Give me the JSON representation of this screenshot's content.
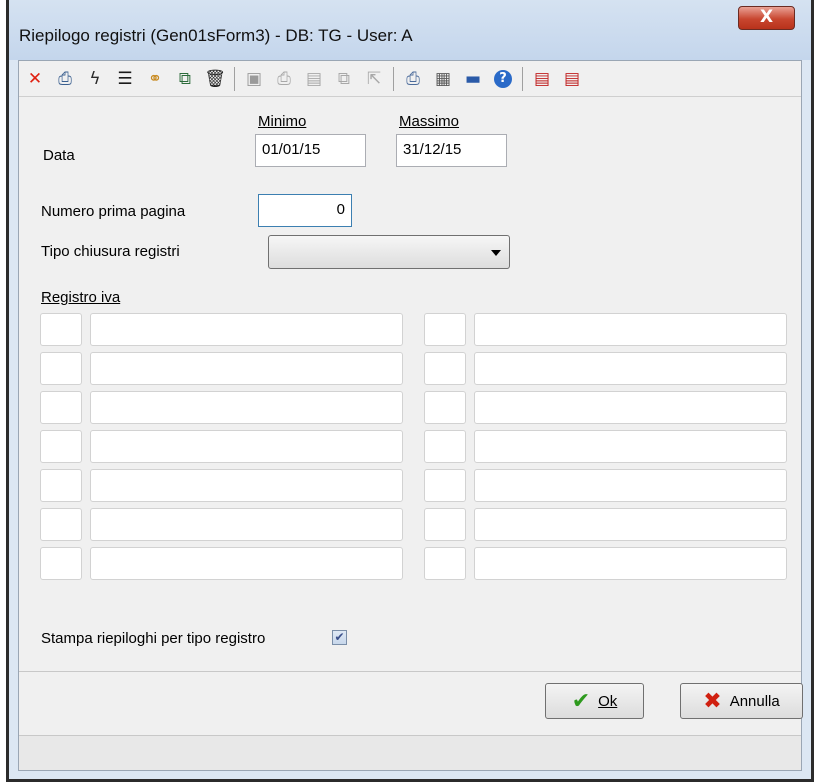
{
  "window": {
    "title": "Riepilogo registri   (Gen01sForm3) - DB: TG - User: A",
    "close_glyph": "X"
  },
  "toolbar": {
    "groups": [
      [
        {
          "name": "delete-icon",
          "glyph": "✕",
          "color": "#e02010"
        },
        {
          "name": "print-icon",
          "glyph": "⎙",
          "color": "#3a5f8f"
        },
        {
          "name": "lightning-icon",
          "glyph": "ϟ",
          "color": "#2a2a2a"
        },
        {
          "name": "list-icon",
          "glyph": "☰",
          "color": "#1a1a1a"
        },
        {
          "name": "handshake-icon",
          "glyph": "⚭",
          "color": "#c88a20"
        },
        {
          "name": "window-icon",
          "glyph": "⧉",
          "color": "#2b6b3a"
        },
        {
          "name": "trash-icon",
          "glyph": "🗑",
          "color": "#222222"
        }
      ],
      [
        {
          "name": "preview-icon",
          "glyph": "▣",
          "color": "#9a9a9a"
        },
        {
          "name": "printer-disabled-icon",
          "glyph": "⎙",
          "color": "#a8a8a8"
        },
        {
          "name": "document-icon",
          "glyph": "▤",
          "color": "#a8a8a8"
        },
        {
          "name": "copy-icon",
          "glyph": "⧉",
          "color": "#a8a8a8"
        },
        {
          "name": "export-icon",
          "glyph": "⇱",
          "color": "#a8a8a8"
        }
      ],
      [
        {
          "name": "printer-setup-icon",
          "glyph": "⎙",
          "color": "#4a6a9a"
        },
        {
          "name": "calculator-icon",
          "glyph": "▦",
          "color": "#5a5a5a"
        },
        {
          "name": "calendar-icon",
          "glyph": "▬",
          "color": "#2a5aa8"
        },
        {
          "name": "help-icon",
          "glyph": "?",
          "color": "#ffffff"
        }
      ],
      [
        {
          "name": "record-up-icon",
          "glyph": "▤",
          "color": "#c02020"
        },
        {
          "name": "record-down-icon",
          "glyph": "▤",
          "color": "#c02020"
        }
      ]
    ]
  },
  "form": {
    "minimo_label": "Minimo",
    "massimo_label": "Massimo",
    "data_label": "Data",
    "data_min": "01/01/15",
    "data_max": "31/12/15",
    "numero_label": "Numero prima pagina",
    "numero_value": "0",
    "tipo_label": "Tipo chiusura registri",
    "tipo_value": "",
    "registro_label": "Registro iva",
    "stampa_label": "Stampa riepiloghi per tipo registro",
    "stampa_checked": true
  },
  "buttons": {
    "ok_label": "Ok",
    "annulla_label": "Annulla"
  },
  "colors": {
    "accent": "#3c7fb1",
    "close": "#c8462f"
  }
}
